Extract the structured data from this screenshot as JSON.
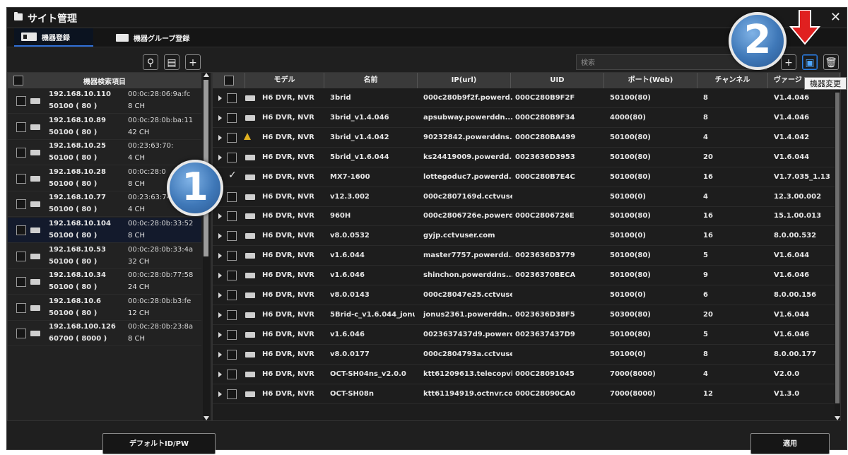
{
  "window": {
    "title": "サイト管理",
    "close_glyph": "✕"
  },
  "tabs": [
    {
      "label": "機器登録",
      "icon": "device-icon",
      "active": true
    },
    {
      "label": "機器グループ登録",
      "icon": "folder-icon",
      "active": false
    }
  ],
  "toolbar": {
    "search_placeholder": "検索",
    "add_glyph": "+",
    "edit_tooltip": "機器変更",
    "delete_glyph": "🗑"
  },
  "left_panel": {
    "header": "機器検索項目",
    "items": [
      {
        "ip": "192.168.10.110",
        "port": "50100 ( 80 )",
        "mac": "00:0c:28:06:9a:fc",
        "ch": "8 CH",
        "selected": false
      },
      {
        "ip": "192.168.10.89",
        "port": "50100 ( 80 )",
        "mac": "00:0c:28:0b:ba:11",
        "ch": "42 CH",
        "selected": false
      },
      {
        "ip": "192.168.10.25",
        "port": "50100 ( 80 )",
        "mac": "00:23:63:70:",
        "ch": "4 CH",
        "selected": false
      },
      {
        "ip": "192.168.10.28",
        "port": "50100 ( 80 )",
        "mac": "00:0c:28:0",
        "ch": "8 CH",
        "selected": false
      },
      {
        "ip": "192.168.10.77",
        "port": "50100 ( 80 )",
        "mac": "00:23:63:74:74:46",
        "ch": "4 CH",
        "selected": false
      },
      {
        "ip": "192.168.10.104",
        "port": "50100 ( 80 )",
        "mac": "00:0c:28:0b:33:52",
        "ch": "8 CH",
        "selected": true
      },
      {
        "ip": "192.168.10.53",
        "port": "50100 ( 80 )",
        "mac": "00:0c:28:0b:33:4a",
        "ch": "32 CH",
        "selected": false
      },
      {
        "ip": "192.168.10.34",
        "port": "50100 ( 80 )",
        "mac": "00:0c:28:0b:77:58",
        "ch": "24 CH",
        "selected": false
      },
      {
        "ip": "192.168.10.6",
        "port": "50100 ( 80 )",
        "mac": "00:0c:28:0b:b3:fe",
        "ch": "12 CH",
        "selected": false
      },
      {
        "ip": "192.168.100.126",
        "port": "60700 ( 8000 )",
        "mac": "00:0c:28:0b:23:8a",
        "ch": "8 CH",
        "selected": false
      }
    ]
  },
  "table": {
    "columns": [
      "モデル",
      "名前",
      "IP(url)",
      "UID",
      "ポート(Web)",
      "チャンネル",
      "ヴァージ"
    ],
    "rows": [
      {
        "model": "H6 DVR, NVR",
        "name": "3brid",
        "ip": "000c280b9f2f.powerd...",
        "uid": "000C280B9F2F",
        "port": "50100(80)",
        "ch": "8",
        "ver": "V1.4.046",
        "checked": false,
        "warn": false
      },
      {
        "model": "H6 DVR, NVR",
        "name": "3brid_v1.4.046",
        "ip": "apsubway.powerddn...",
        "uid": "000C280B9F34",
        "port": "4000(80)",
        "ch": "8",
        "ver": "V1.4.046",
        "checked": false,
        "warn": false
      },
      {
        "model": "H6 DVR, NVR",
        "name": "3brid_v1.4.042",
        "ip": "90232842.powerddns....",
        "uid": "000C280BA499",
        "port": "50100(80)",
        "ch": "4",
        "ver": "V1.4.042",
        "checked": false,
        "warn": true
      },
      {
        "model": "H6 DVR, NVR",
        "name": "5brid_v1.6.044",
        "ip": "ks24419009.powerdd...",
        "uid": "0023636D3953",
        "port": "50100(80)",
        "ch": "20",
        "ver": "V1.6.044",
        "checked": false,
        "warn": false
      },
      {
        "model": "H6 DVR, NVR",
        "name": "MX7-1600",
        "ip": "lottegoduc7.powerdd...",
        "uid": "000C280B7E4C",
        "port": "50100(80)",
        "ch": "16",
        "ver": "V1.7.035_1.13",
        "checked": true,
        "warn": false
      },
      {
        "model": "H6 DVR, NVR",
        "name": "v12.3.002",
        "ip": "000c2807169d.cctvuse...",
        "uid": "",
        "port": "50100(0)",
        "ch": "4",
        "ver": "12.3.00.002",
        "checked": false,
        "warn": false
      },
      {
        "model": "H6 DVR, NVR",
        "name": "960H",
        "ip": "000c2806726e.powerd...",
        "uid": "000C2806726E",
        "port": "50100(80)",
        "ch": "16",
        "ver": "15.1.00.013",
        "checked": false,
        "warn": false
      },
      {
        "model": "H6 DVR, NVR",
        "name": "v8.0.0532",
        "ip": "gyjp.cctvuser.com",
        "uid": "",
        "port": "50100(0)",
        "ch": "16",
        "ver": "8.0.00.532",
        "checked": false,
        "warn": false
      },
      {
        "model": "H6 DVR, NVR",
        "name": "v1.6.044",
        "ip": "master7757.powerdd...",
        "uid": "0023636D3779",
        "port": "50100(80)",
        "ch": "5",
        "ver": "V1.6.044",
        "checked": false,
        "warn": false
      },
      {
        "model": "H6 DVR, NVR",
        "name": "v1.6.046",
        "ip": "shinchon.powerddns...",
        "uid": "00236370BECA",
        "port": "50100(80)",
        "ch": "9",
        "ver": "V1.6.046",
        "checked": false,
        "warn": false
      },
      {
        "model": "H6 DVR, NVR",
        "name": "v8.0.0143",
        "ip": "000c28047e25.cctvuse...",
        "uid": "",
        "port": "50100(0)",
        "ch": "6",
        "ver": "8.0.00.156",
        "checked": false,
        "warn": false
      },
      {
        "model": "H6 DVR, NVR",
        "name": "5Brid-c_v1.6.044_jonu...",
        "ip": "jonus2361.powerddn...",
        "uid": "0023636D38F5",
        "port": "50300(80)",
        "ch": "20",
        "ver": "V1.6.044",
        "checked": false,
        "warn": false
      },
      {
        "model": "H6 DVR, NVR",
        "name": "v1.6.046",
        "ip": "0023637437d9.powerd...",
        "uid": "0023637437D9",
        "port": "50100(80)",
        "ch": "5",
        "ver": "V1.6.046",
        "checked": false,
        "warn": false
      },
      {
        "model": "H6 DVR, NVR",
        "name": "v8.0.0177",
        "ip": "000c2804793a.cctvuse...",
        "uid": "",
        "port": "50100(0)",
        "ch": "8",
        "ver": "8.0.00.177",
        "checked": false,
        "warn": false
      },
      {
        "model": "H6 DVR, NVR",
        "name": "OCT-SH04ns_v2.0.0",
        "ip": "ktt61209613.telecopvi...",
        "uid": "000C28091045",
        "port": "7000(8000)",
        "ch": "4",
        "ver": "V2.0.0",
        "checked": false,
        "warn": false
      },
      {
        "model": "H6 DVR, NVR",
        "name": "OCT-SH08n",
        "ip": "ktt61194919.octnvr.co.kr",
        "uid": "000C28090CA0",
        "port": "7000(8000)",
        "ch": "12",
        "ver": "V1.3.0",
        "checked": false,
        "warn": false
      }
    ]
  },
  "buttons": {
    "default_idpw": "デフォルトID/PW",
    "apply": "適用"
  },
  "annotations": {
    "badge1": "1",
    "badge2": "2"
  },
  "colors": {
    "accent": "#2f7fe0",
    "selected_row": "#131a2c",
    "warn": "#e0b020",
    "annotation_arrow": "#e02020"
  }
}
